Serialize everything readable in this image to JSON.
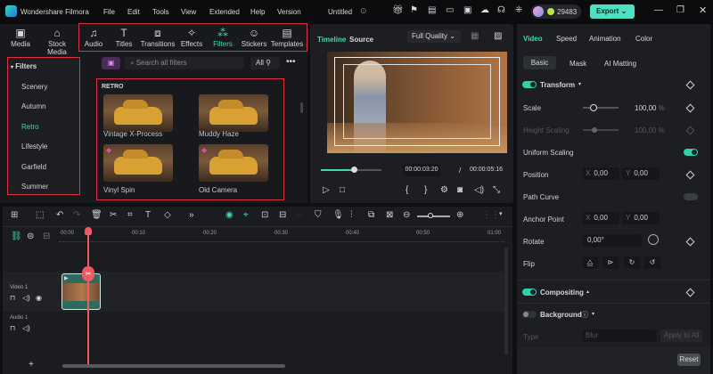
{
  "app": {
    "title": "Wondershare Filmora",
    "project": "Untitled",
    "credits": "29483",
    "export": "Export"
  },
  "menu": [
    "File",
    "Edit",
    "Tools",
    "View",
    "Extended",
    "Help",
    "Version"
  ],
  "toolbar_tabs": [
    {
      "label": "Media",
      "icon": "media-icon"
    },
    {
      "label": "Stock Media",
      "icon": "stock-icon"
    },
    {
      "label": "Audio",
      "icon": "music-icon"
    },
    {
      "label": "Titles",
      "icon": "title-icon"
    },
    {
      "label": "Transitions",
      "icon": "transition-icon"
    },
    {
      "label": "Effects",
      "icon": "effects-icon"
    },
    {
      "label": "Filters",
      "icon": "filters-icon"
    },
    {
      "label": "Stickers",
      "icon": "sticker-icon"
    },
    {
      "label": "Templates",
      "icon": "template-icon"
    }
  ],
  "sidebar": {
    "header": "Filters",
    "items": [
      "Scenery",
      "Autumn",
      "Retro",
      "Lifestyle",
      "Garfield",
      "Summer"
    ],
    "active": "Retro"
  },
  "search": {
    "placeholder": "Search all filters",
    "filter_label": "All"
  },
  "grid": {
    "section": "RETRO",
    "items": [
      "Vintage X-Process",
      "Muddy Haze",
      "Vinyl Spin",
      "Old Camera"
    ]
  },
  "preview": {
    "tabs": [
      "Timeline",
      "Source"
    ],
    "quality": "Full Quality",
    "current": "00:00:03:20",
    "sep": "/",
    "total": "00:00:05:16",
    "progress": 0.55
  },
  "props": {
    "tabs": [
      "Video",
      "Speed",
      "Animation",
      "Color"
    ],
    "subtabs": [
      "Basic",
      "Mask",
      "AI Matting"
    ],
    "transform": "Transform",
    "scale_label": "Scale",
    "scale": "100,00",
    "pct": "%",
    "height_label": "Height Scaling",
    "height": "100,00",
    "uniform": "Uniform Scaling",
    "position": "Position",
    "x": "X",
    "y": "Y",
    "pos_x": "0,00",
    "pos_y": "0,00",
    "path_curve": "Path Curve",
    "anchor": "Anchor Point",
    "anc_x": "0,00",
    "anc_y": "0,00",
    "rotate": "Rotate",
    "rotate_val": "0,00°",
    "flip": "Flip",
    "compositing": "Compositing",
    "background": "Background",
    "type_label": "Type",
    "type_val": "Blur",
    "apply_all": "Apply to All",
    "reset": "Reset"
  },
  "timeline": {
    "ruler": [
      "00:00",
      "00:10",
      "00:20",
      "00:30",
      "00:40",
      "00:50",
      "01:00"
    ],
    "tracks": [
      "Video 1",
      "Audio 1"
    ]
  }
}
